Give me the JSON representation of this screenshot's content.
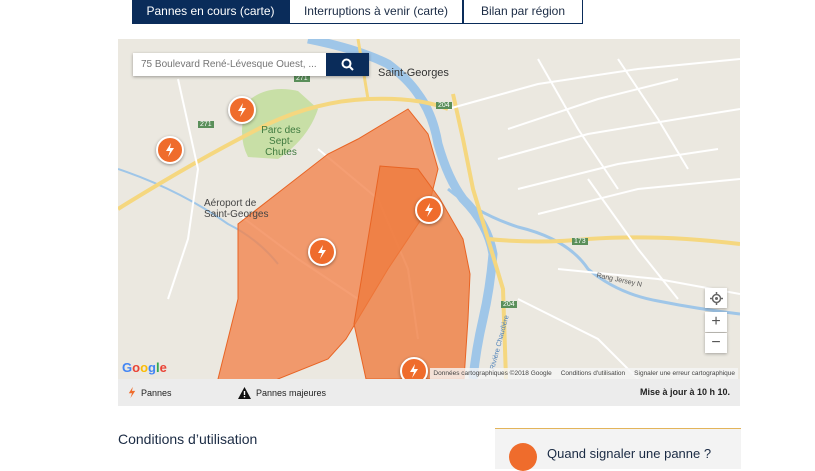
{
  "tabs": [
    {
      "label": "Pannes en cours (carte)",
      "active": true
    },
    {
      "label": "Interruptions à venir (carte)",
      "active": false
    },
    {
      "label": "Bilan par région",
      "active": false
    }
  ],
  "map": {
    "search_placeholder": "75 Boulevard René-Lévesque Ouest, ...",
    "labels": {
      "city": "Saint-Georges",
      "park": "Parc des Sept-Chutes",
      "airport": "Aéroport de Saint-Georges",
      "route_271": "271",
      "route_204a": "204",
      "route_204b": "204",
      "route_173": "173",
      "river": "Rivière Chaudière",
      "rang_jersey": "Rang Jersey N"
    },
    "google_logo": "Google",
    "attribution": {
      "data": "Données cartographiques ©2018 Google",
      "terms": "Conditions d'utilisation",
      "report": "Signaler une erreur cartographique"
    },
    "zoom_in": "+",
    "zoom_out": "−",
    "colors": {
      "outage": "#ef6c2c",
      "zone_fill": "#f2834c",
      "tab_active": "#0a2c5a"
    }
  },
  "legend": {
    "pannes": "Pannes",
    "pannes_majeures": "Pannes majeures",
    "update": "Mise à jour à 10 h 10."
  },
  "conditions_title": "Conditions d’utilisation",
  "card_title": "Quand signaler une panne ?"
}
